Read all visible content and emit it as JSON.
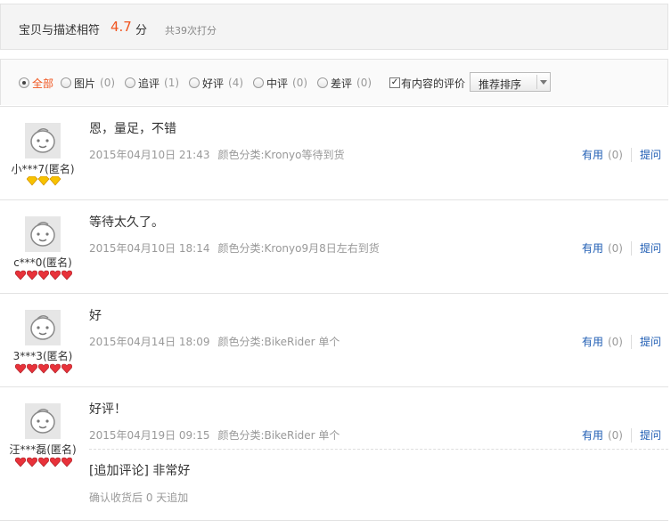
{
  "summary": {
    "label": "宝贝与描述相符",
    "score": "4.7",
    "unit": "分",
    "count": "共39次打分"
  },
  "filters": {
    "items": [
      {
        "label": "全部",
        "count": "",
        "selected": true
      },
      {
        "label": "图片",
        "count": "(0)",
        "selected": false
      },
      {
        "label": "追评",
        "count": "(1)",
        "selected": false
      },
      {
        "label": "好评",
        "count": "(4)",
        "selected": false
      },
      {
        "label": "中评",
        "count": "(0)",
        "selected": false
      },
      {
        "label": "差评",
        "count": "(0)",
        "selected": false
      }
    ],
    "has_content_label": "有内容的评价",
    "has_content_checked": true,
    "sort_value": "推荐排序"
  },
  "reviews": [
    {
      "user": "小***7(匿名)",
      "badge_type": "gold",
      "badge_count": 3,
      "content": "恩，量足，不错",
      "date": "2015年04月10日 21:43",
      "category": "颜色分类:Kronyo等待到货",
      "useful_label": "有用",
      "useful_count": "(0)",
      "reply_label": "提问"
    },
    {
      "user": "c***0(匿名)",
      "badge_type": "red",
      "badge_count": 5,
      "content": "等待太久了。",
      "date": "2015年04月10日 18:14",
      "category": "颜色分类:Kronyo9月8日左右到货",
      "useful_label": "有用",
      "useful_count": "(0)",
      "reply_label": "提问"
    },
    {
      "user": "3***3(匿名)",
      "badge_type": "red",
      "badge_count": 5,
      "content": "好",
      "date": "2015年04月14日 18:09",
      "category": "颜色分类:BikeRider 单个",
      "useful_label": "有用",
      "useful_count": "(0)",
      "reply_label": "提问"
    },
    {
      "user": "汪***磊(匿名)",
      "badge_type": "red",
      "badge_count": 5,
      "content": "好评！",
      "date": "2015年04月19日 09:15",
      "category": "颜色分类:BikeRider 单个",
      "useful_label": "有用",
      "useful_count": "(0)",
      "reply_label": "提问",
      "append_content": "[追加评论] 非常好",
      "append_meta": "确认收货后 0 天追加"
    }
  ],
  "colors": {
    "accent": "#f0541e",
    "link": "#1e5cb3",
    "badge_gold": "#f5b400",
    "badge_red": "#e0282e"
  }
}
